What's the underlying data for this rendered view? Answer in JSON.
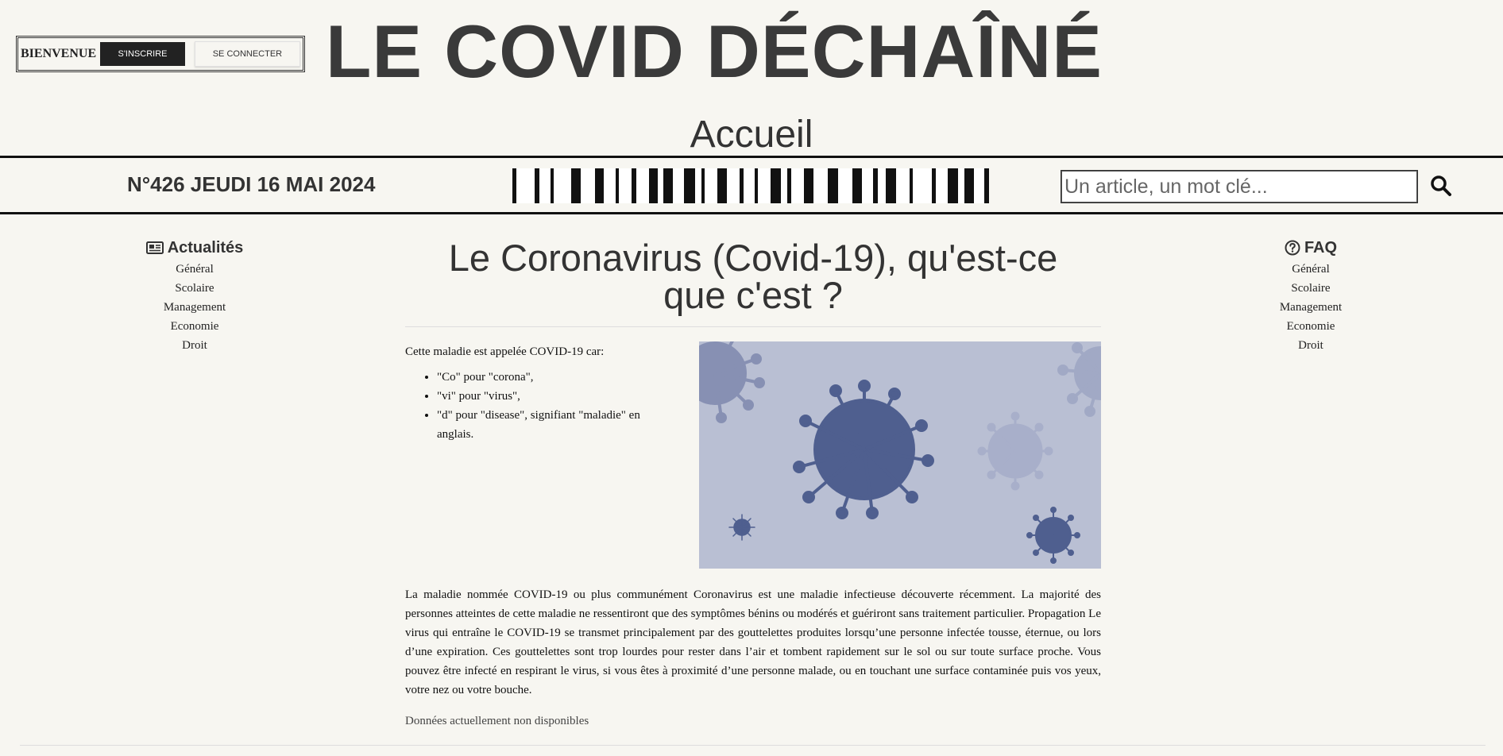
{
  "auth": {
    "welcome": "BIENVENUE",
    "signup_label": "S'INSCRIRE",
    "login_label": "SE CONNECTER"
  },
  "site": {
    "title": "LE COVID DÉCHAÎNÉ",
    "page_heading": "Accueil"
  },
  "bar": {
    "issue": "N°426 JEUDI 16 MAI 2024",
    "search_placeholder": "Un article, un mot clé...",
    "search_icon": "search-icon"
  },
  "left_nav": {
    "icon": "newspaper-icon",
    "title": "Actualités",
    "items": [
      "Général",
      "Scolaire",
      "Management",
      "Economie",
      "Droit"
    ]
  },
  "right_nav": {
    "icon": "question-circle-icon",
    "title": "FAQ",
    "items": [
      "Général",
      "Scolaire",
      "Management",
      "Economie",
      "Droit"
    ]
  },
  "article": {
    "title": "Le Coronavirus (Covid-19), qu'est-ce que c'est ?",
    "intro": "Cette maladie est appelée COVID-19 car:",
    "bullets": [
      "\"Co\" pour \"corona\",",
      "\"vi\" pour \"virus\",",
      "\"d\" pour \"disease\", signifiant \"maladie\" en anglais."
    ],
    "image": "coronavirus-illustration",
    "body": "La maladie nommée COVID-19 ou plus communément Coronavirus est une maladie infectieuse découverte récemment.  La majorité des personnes atteintes de cette maladie ne ressentiront que des symptômes bénins ou modérés et guériront sans traitement particulier. Propagation Le virus qui entraîne le COVID-19 se transmet principalement par des gouttelettes produites lorsqu’une personne infectée tousse, éternue, ou lors d’une expiration. Ces gouttelettes sont trop lourdes pour rester dans l’air et tombent rapidement sur le sol ou sur toute surface proche. Vous pouvez être infecté en respirant le virus, si vous êtes à proximité d’une personne malade, ou en touchant une surface contaminée puis vos yeux, votre nez ou votre bouche.",
    "unavailable": "Données actuellement non disponibles"
  },
  "colors": {
    "background": "#f7f6f1",
    "text": "#333333",
    "image_bg": "#b9bfd3",
    "virus_dark": "#4f5f8f"
  }
}
